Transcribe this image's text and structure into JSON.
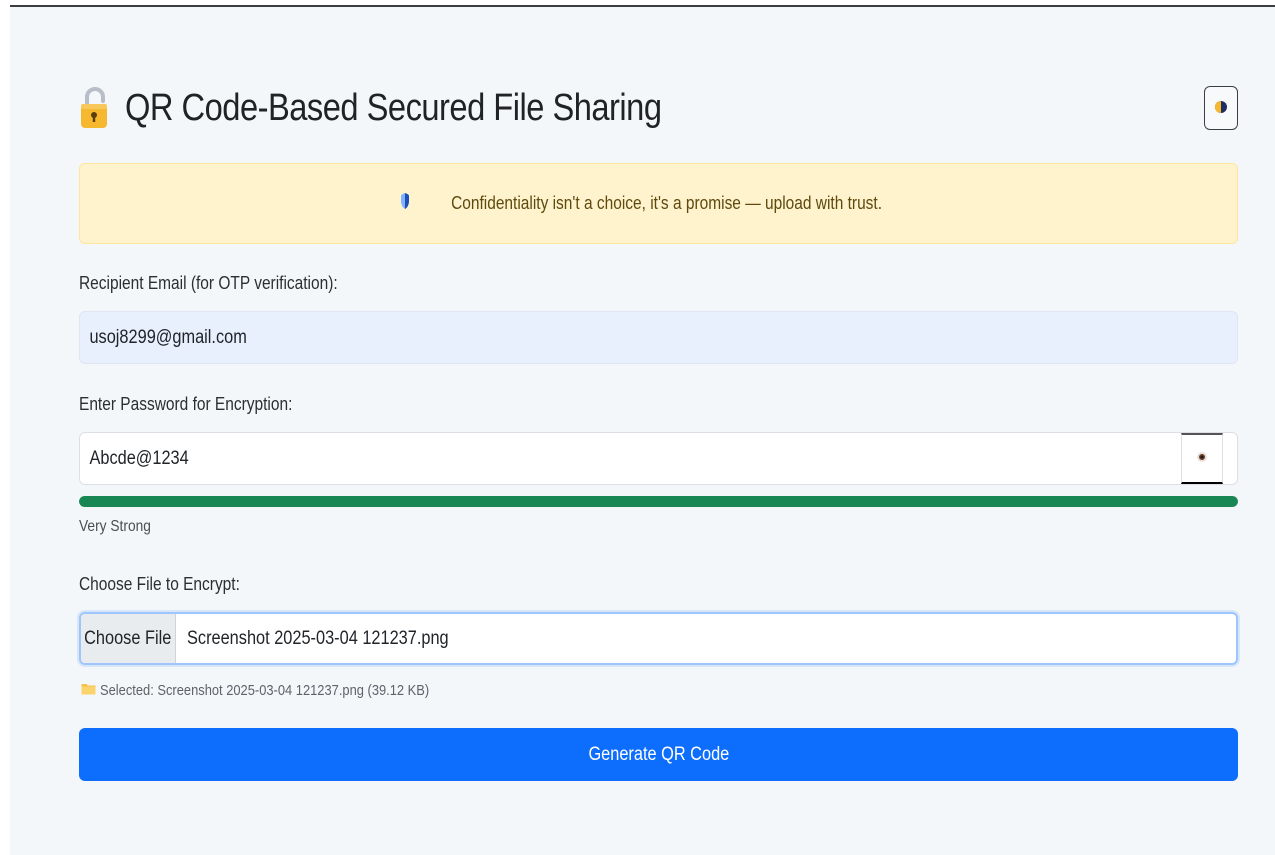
{
  "header": {
    "title": "QR Code-Based Secured File Sharing",
    "lock_icon": "lock-icon",
    "theme_toggle_icon": "contrast-icon"
  },
  "banner": {
    "icon": "shield-icon",
    "text": "Confidentiality isn't a choice, it's a promise — upload with trust."
  },
  "form": {
    "email_label": "Recipient Email (for OTP verification):",
    "email_value": "usoj8299@gmail.com",
    "password_label": "Enter Password for Encryption:",
    "password_value": "Abcde@1234",
    "password_toggle_icon": "eye-icon",
    "strength": {
      "level_percent": 100,
      "text": "Very Strong",
      "color": "#198754"
    },
    "file_label": "Choose File to Encrypt:",
    "file_button": "Choose File",
    "file_name": "Screenshot 2025-03-04 121237.png",
    "selected_icon": "folder-icon",
    "selected_text": "Selected: Screenshot 2025-03-04 121237.png (39.12 KB)",
    "submit_label": "Generate QR Code"
  },
  "colors": {
    "primary": "#0d6efd",
    "banner_bg": "#fff3cd",
    "success": "#198754"
  }
}
